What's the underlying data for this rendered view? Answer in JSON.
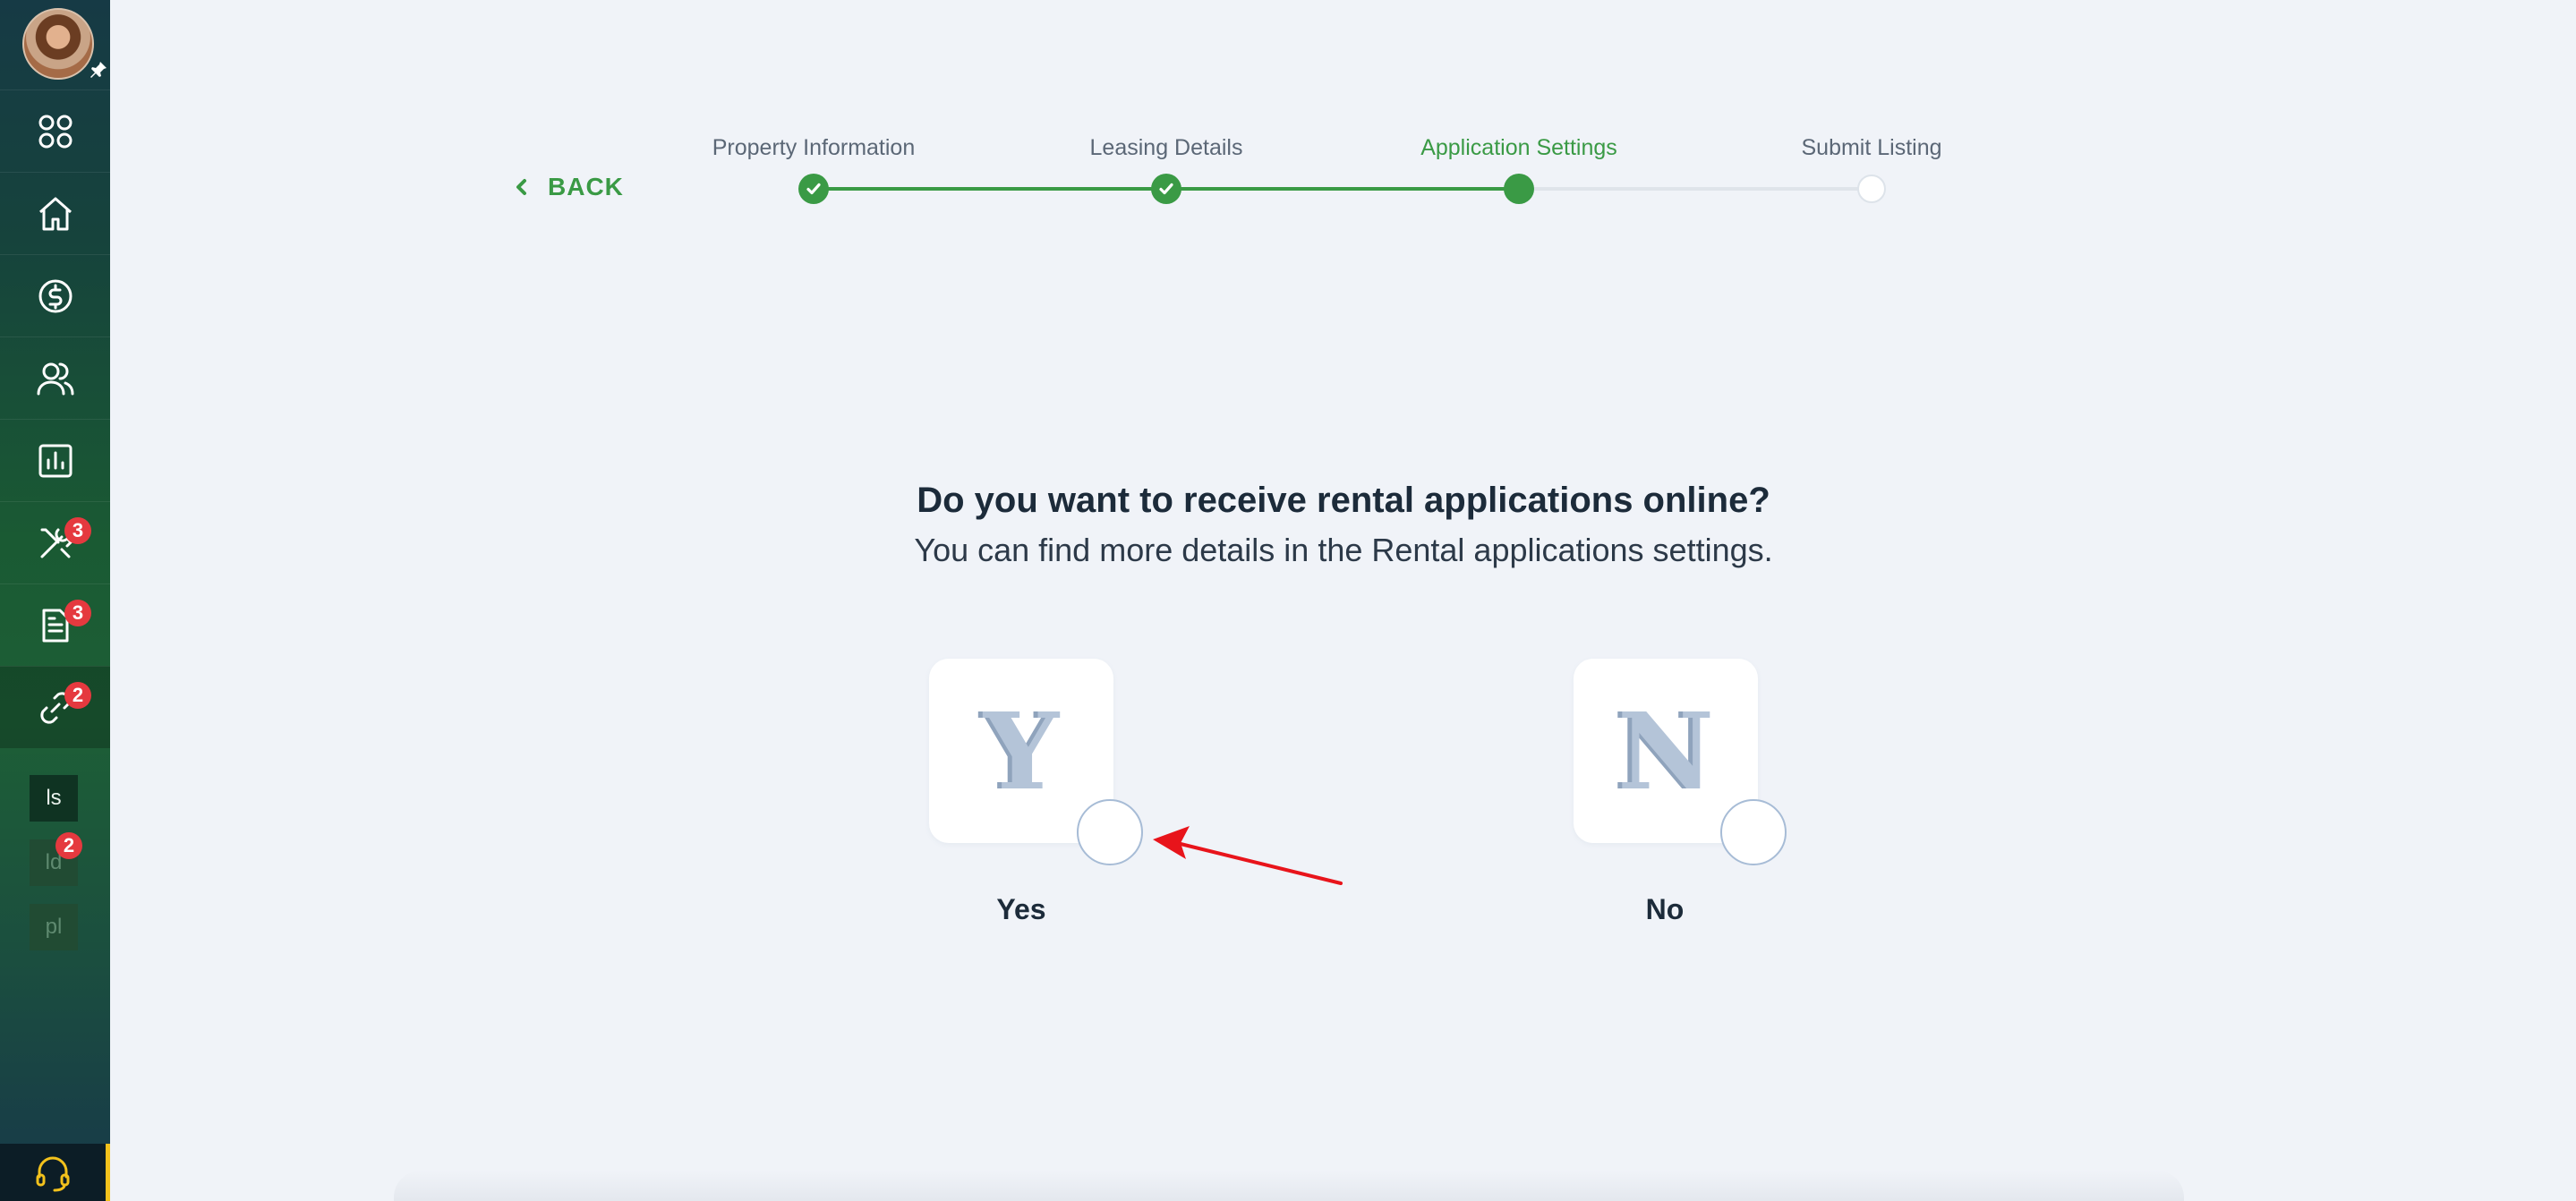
{
  "sidebar": {
    "nav": [
      {
        "icon": "apps-grid-icon"
      },
      {
        "icon": "home-icon"
      },
      {
        "icon": "dollar-circle-icon"
      },
      {
        "icon": "people-icon"
      },
      {
        "icon": "bar-chart-icon"
      },
      {
        "icon": "tools-icon",
        "badge": "3"
      },
      {
        "icon": "document-icon",
        "badge": "3"
      },
      {
        "icon": "link-icon",
        "badge": "2",
        "active": true
      }
    ],
    "mini_items": [
      {
        "label": "ls"
      },
      {
        "label": "ld",
        "badge": "2"
      },
      {
        "label": "pl"
      }
    ],
    "support_icon": "headset-icon"
  },
  "stepper": {
    "back_label": "BACK",
    "steps": [
      {
        "label": "Property Information",
        "status": "done"
      },
      {
        "label": "Leasing Details",
        "status": "done"
      },
      {
        "label": "Application Settings",
        "status": "current"
      },
      {
        "label": "Submit Listing",
        "status": "todo"
      }
    ]
  },
  "question": {
    "title": "Do you want to receive rental applications online?",
    "subtitle": "You can find more details in the Rental applications settings."
  },
  "options": [
    {
      "letter": "Y",
      "label": "Yes",
      "selected": false
    },
    {
      "letter": "N",
      "label": "No",
      "selected": false
    }
  ],
  "colors": {
    "accent_green": "#3a9a45",
    "badge_red": "#e5393f",
    "annotation_arrow": "#e8141b",
    "support_accent": "#f3c21c"
  }
}
